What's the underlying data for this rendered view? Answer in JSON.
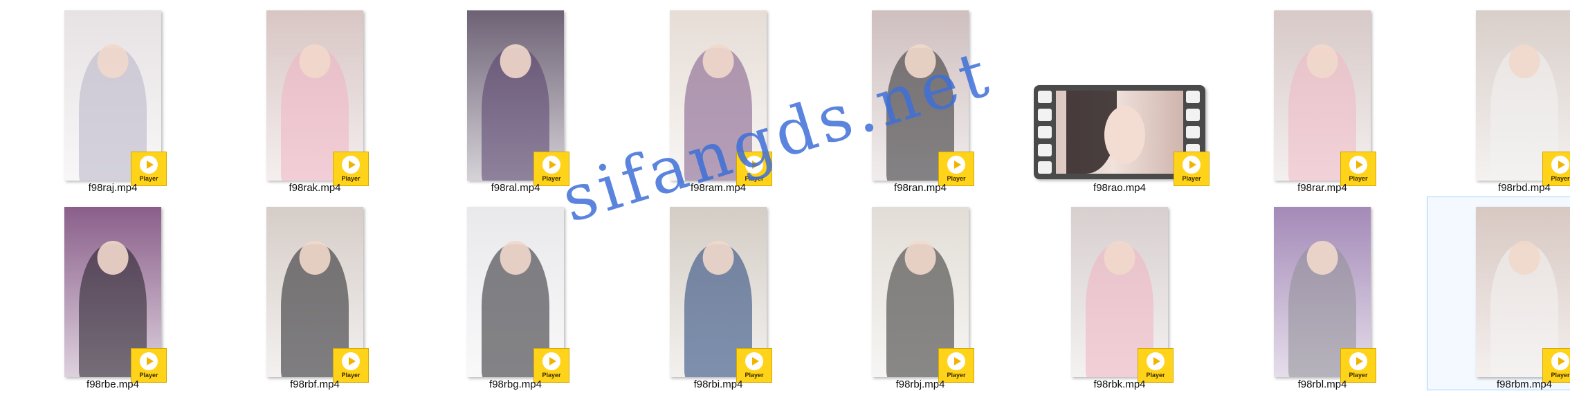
{
  "files": [
    {
      "name": "f98raj.mp4",
      "bg": "#e7e2e4",
      "tone": "#b7b2c6"
    },
    {
      "name": "f98rak.mp4",
      "bg": "#d8c6c4",
      "tone": "#f0b3c2"
    },
    {
      "name": "f98ral.mp4",
      "bg": "#6d6275",
      "tone": "#55406b"
    },
    {
      "name": "f98ram.mp4",
      "bg": "#e6ddd6",
      "tone": "#7b5687"
    },
    {
      "name": "f98ran.mp4",
      "bg": "#cfbfbf",
      "tone": "#2a2a2e"
    },
    {
      "name": "f98rao.mp4",
      "bg": "#4a4a4a",
      "tone": "#f0e2dc"
    },
    {
      "name": "f98rar.mp4",
      "bg": "#d7c9c7",
      "tone": "#f1b8c5"
    },
    {
      "name": "f98rbd.mp4",
      "bg": "#d9cfca",
      "tone": "#f3f3f3"
    },
    {
      "name": "f98rbe.mp4",
      "bg": "#8a5f8a",
      "tone": "#1f1c24"
    },
    {
      "name": "f98rbf.mp4",
      "bg": "#d6cdc8",
      "tone": "#1f1f24"
    },
    {
      "name": "f98rbg.mp4",
      "bg": "#e9e9ec",
      "tone": "#222228"
    },
    {
      "name": "f98rbi.mp4",
      "bg": "#d4cdc5",
      "tone": "#1f3f78"
    },
    {
      "name": "f98rbj.mp4",
      "bg": "#e2ddd6",
      "tone": "#2d2d2d"
    },
    {
      "name": "f98rbk.mp4",
      "bg": "#d8cfcf",
      "tone": "#f1b2c1"
    },
    {
      "name": "f98rbl.mp4",
      "bg": "#a48ab8",
      "tone": "#8f8f96"
    },
    {
      "name": "f98rbm.mp4",
      "bg": "#d8c8c2",
      "tone": "#f4f4f4"
    }
  ],
  "player_label": "Player",
  "watermark": "sifangds.net"
}
